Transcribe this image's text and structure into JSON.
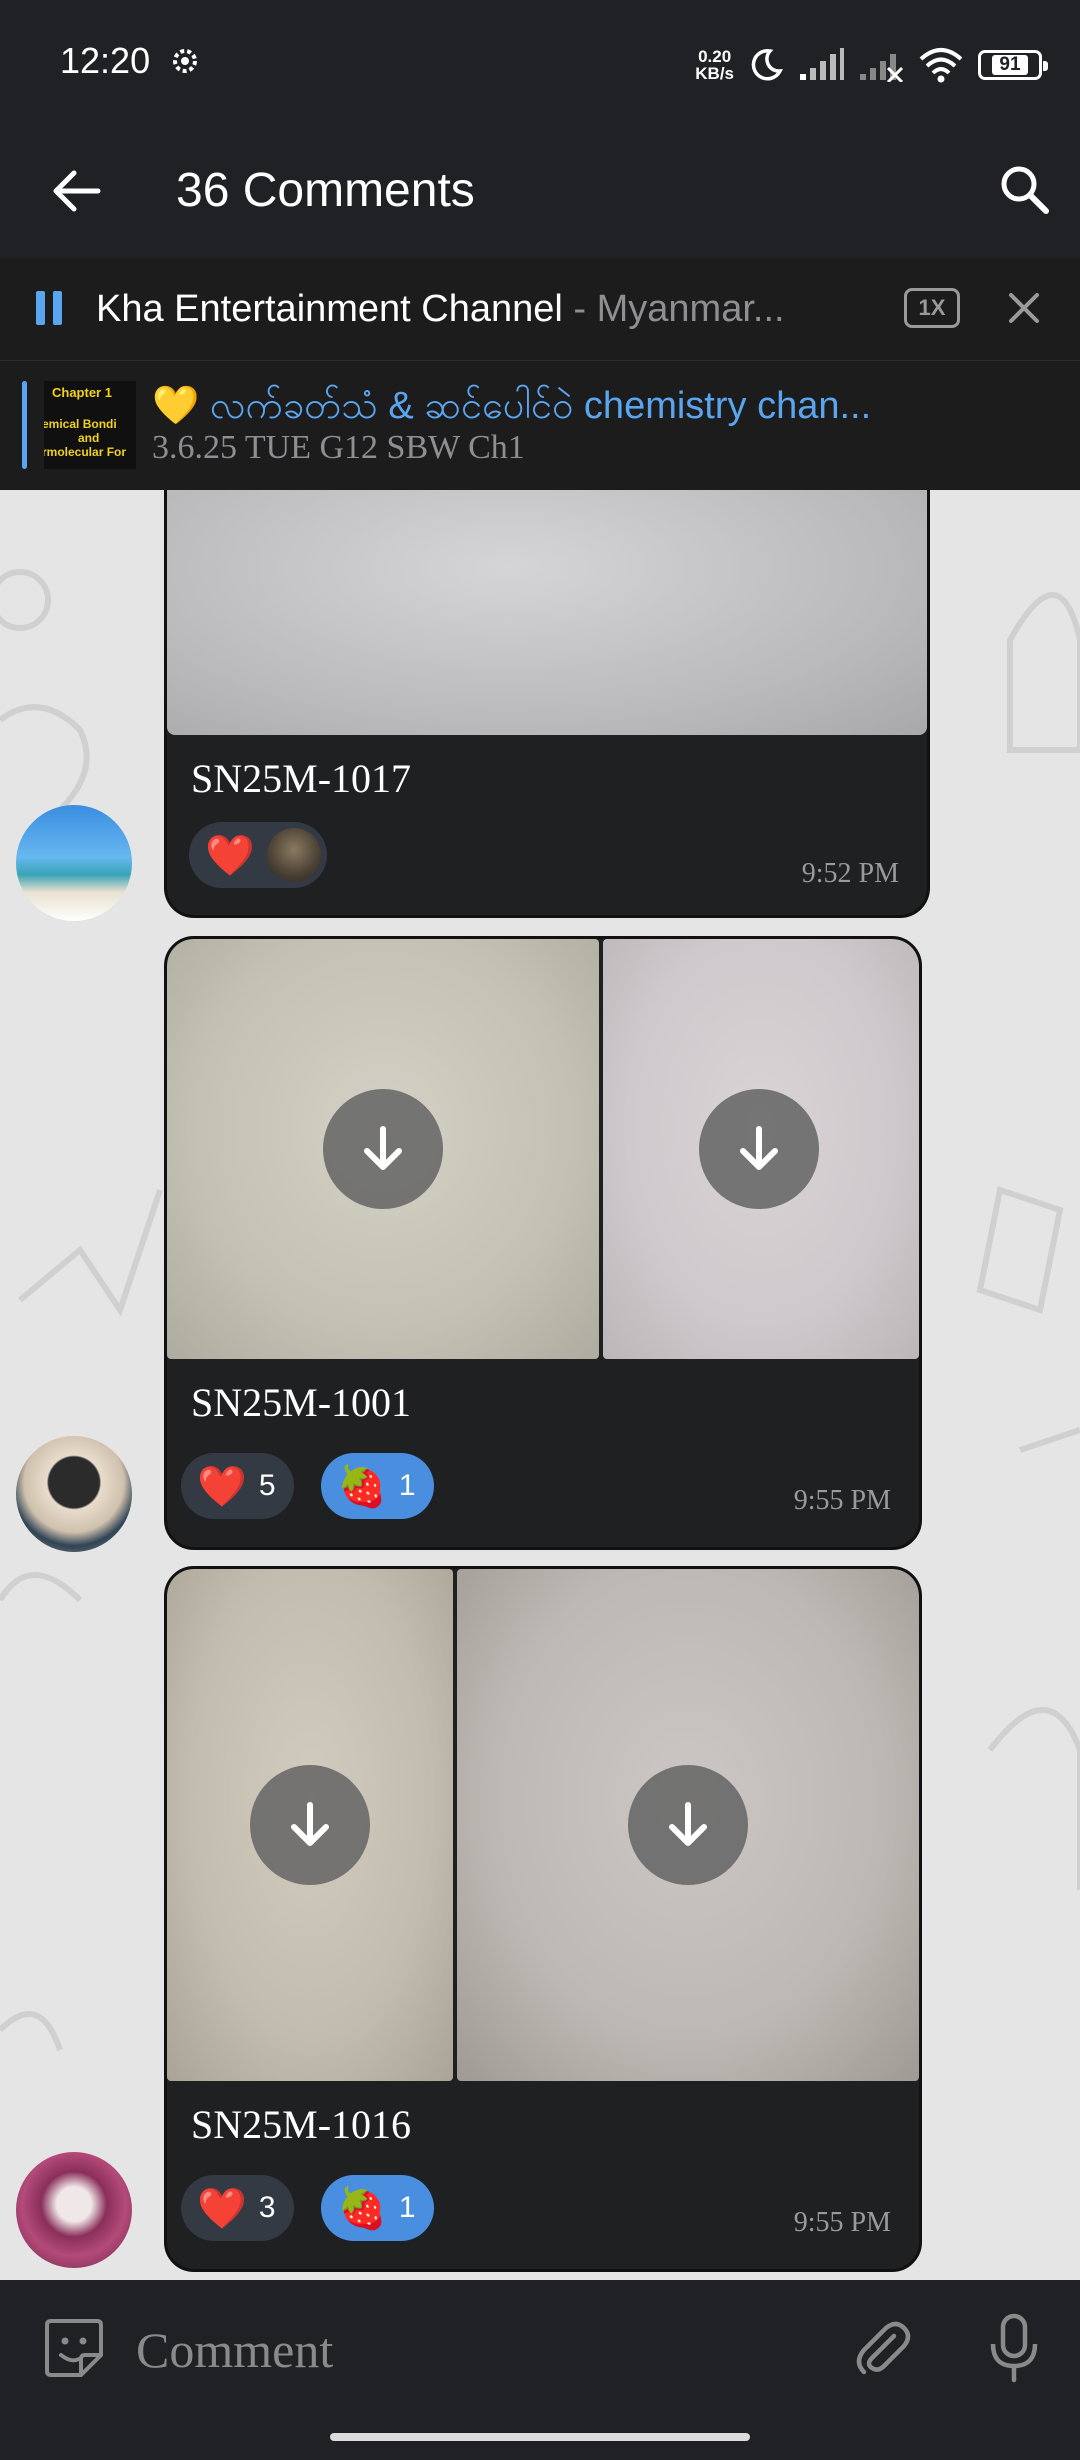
{
  "status_bar": {
    "time": "12:20",
    "speed_top": "0.20",
    "speed_bottom": "KB/s",
    "battery": "91",
    "icons": [
      "gear-icon",
      "moon-icon",
      "signal-icon",
      "signal-off-icon",
      "wifi-icon",
      "battery-icon"
    ]
  },
  "header": {
    "title": "36 Comments",
    "back_icon": "arrow-left-icon",
    "search_icon": "search-icon"
  },
  "player": {
    "title": "Kha Entertainment Channel",
    "subtitle": " - Myanmar...",
    "speed": "1X"
  },
  "pinned": {
    "thumb_line1": "Chapter 1",
    "thumb_line2": "emical Bondi",
    "thumb_line3": "and",
    "thumb_line4": "rmolecular For",
    "heart": "💛",
    "text": " လက်ခတ်သံ & ဆင်ပေါင်ဝဲ chemistry chan...",
    "line2": "3.6.25 TUE  G12 SBW  Ch1"
  },
  "messages": [
    {
      "caption": "SN25M-1017",
      "time": "9:52 PM",
      "reactions": [
        {
          "emoji": "❤️",
          "count": ""
        }
      ]
    },
    {
      "caption": "SN25M-1001",
      "time": "9:55 PM",
      "reactions": [
        {
          "emoji": "❤️",
          "count": "5"
        },
        {
          "emoji": "🍓",
          "count": "1"
        }
      ]
    },
    {
      "caption": "SN25M-1016",
      "time": "9:55 PM",
      "reactions": [
        {
          "emoji": "❤️",
          "count": "3"
        },
        {
          "emoji": "🍓",
          "count": "1"
        }
      ]
    }
  ],
  "input": {
    "placeholder": "Comment"
  },
  "colors": {
    "bar_bg": "#202124",
    "accent": "#5aa5f0",
    "bubble_bg": "#1f2022",
    "chat_bg": "#e5e5e5",
    "reaction_blue": "#4a8ee0"
  }
}
